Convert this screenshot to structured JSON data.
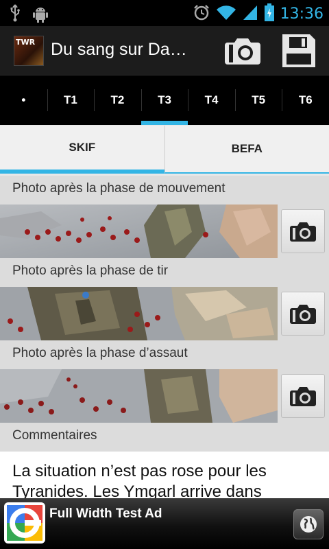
{
  "status_bar": {
    "time": "13:36",
    "icons": [
      "usb-icon",
      "android-debug-icon",
      "alarm-icon",
      "wifi-icon",
      "signal-icon",
      "battery-charging-icon"
    ]
  },
  "action_bar": {
    "title": "Du sang sur Da…",
    "app_icon_text": "TWR",
    "actions": [
      "camera-icon",
      "save-icon"
    ]
  },
  "turn_tabs": [
    {
      "label": "•",
      "active": false
    },
    {
      "label": "T1",
      "active": false
    },
    {
      "label": "T2",
      "active": false
    },
    {
      "label": "T3",
      "active": true
    },
    {
      "label": "T4",
      "active": false
    },
    {
      "label": "T5",
      "active": false
    },
    {
      "label": "T6",
      "active": false
    }
  ],
  "player_tabs": [
    {
      "label": "SKIF",
      "active": true
    },
    {
      "label": "BEFA",
      "active": false
    }
  ],
  "sections": {
    "movement": "Photo après la phase de mouvement",
    "shooting": "Photo après la phase de tir",
    "assault": "Photo après la phase d’assaut",
    "comments": "Commentaires"
  },
  "comment_text": "La situation n’est pas rose pour les Tyranides. Les Ymgarl arrive dans",
  "ad": {
    "text": "Full Width Test Ad"
  },
  "colors": {
    "accent": "#33b5e5",
    "status_bar": "#000000",
    "action_bar": "#1c1c1c",
    "background": "#dcdcdc"
  }
}
